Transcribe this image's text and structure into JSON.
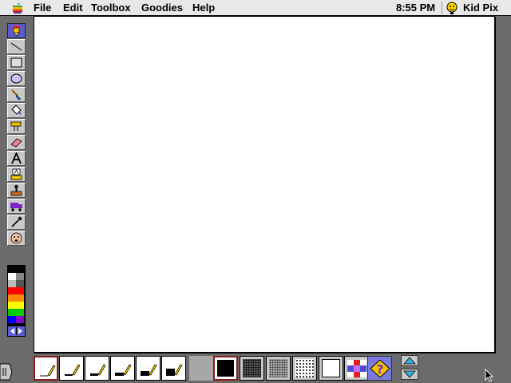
{
  "menubar": {
    "apple_icon": "apple-icon",
    "items": [
      {
        "label": "File"
      },
      {
        "label": "Edit"
      },
      {
        "label": "Toolbox"
      },
      {
        "label": "Goodies"
      },
      {
        "label": "Help"
      }
    ],
    "clock": "8:55 PM",
    "app_name": "Kid Pix",
    "app_icon": "kid-pix-face-icon"
  },
  "tools": [
    {
      "name": "wacky-pencil-icon",
      "selected": true
    },
    {
      "name": "line-icon",
      "selected": false
    },
    {
      "name": "rectangle-icon",
      "selected": false
    },
    {
      "name": "oval-icon",
      "selected": false
    },
    {
      "name": "wacky-brush-icon",
      "selected": false
    },
    {
      "name": "paint-bucket-icon",
      "selected": false
    },
    {
      "name": "electric-mixer-icon",
      "selected": false
    },
    {
      "name": "eraser-icon",
      "selected": false
    },
    {
      "name": "text-icon",
      "selected": false
    },
    {
      "name": "alphabet-stamp-icon",
      "selected": false
    },
    {
      "name": "rubber-stamp-icon",
      "selected": false
    },
    {
      "name": "moving-van-icon",
      "selected": false
    },
    {
      "name": "eyedropper-icon",
      "selected": false
    },
    {
      "name": "undo-guy-icon",
      "selected": false
    }
  ],
  "colors": [
    "#000000",
    "#ffffff",
    "#bbbbbb",
    "#888888",
    "#ff0000",
    "#ff8800",
    "#ffff00",
    "#00cc00",
    "#0000ff",
    "#8800cc"
  ],
  "pencil_sizes": 6,
  "fill_options": [
    "black-fill",
    "dark-pattern",
    "light-pattern",
    "dotted-pattern",
    "white-fill",
    "color-pattern",
    "random-fill-icon"
  ]
}
